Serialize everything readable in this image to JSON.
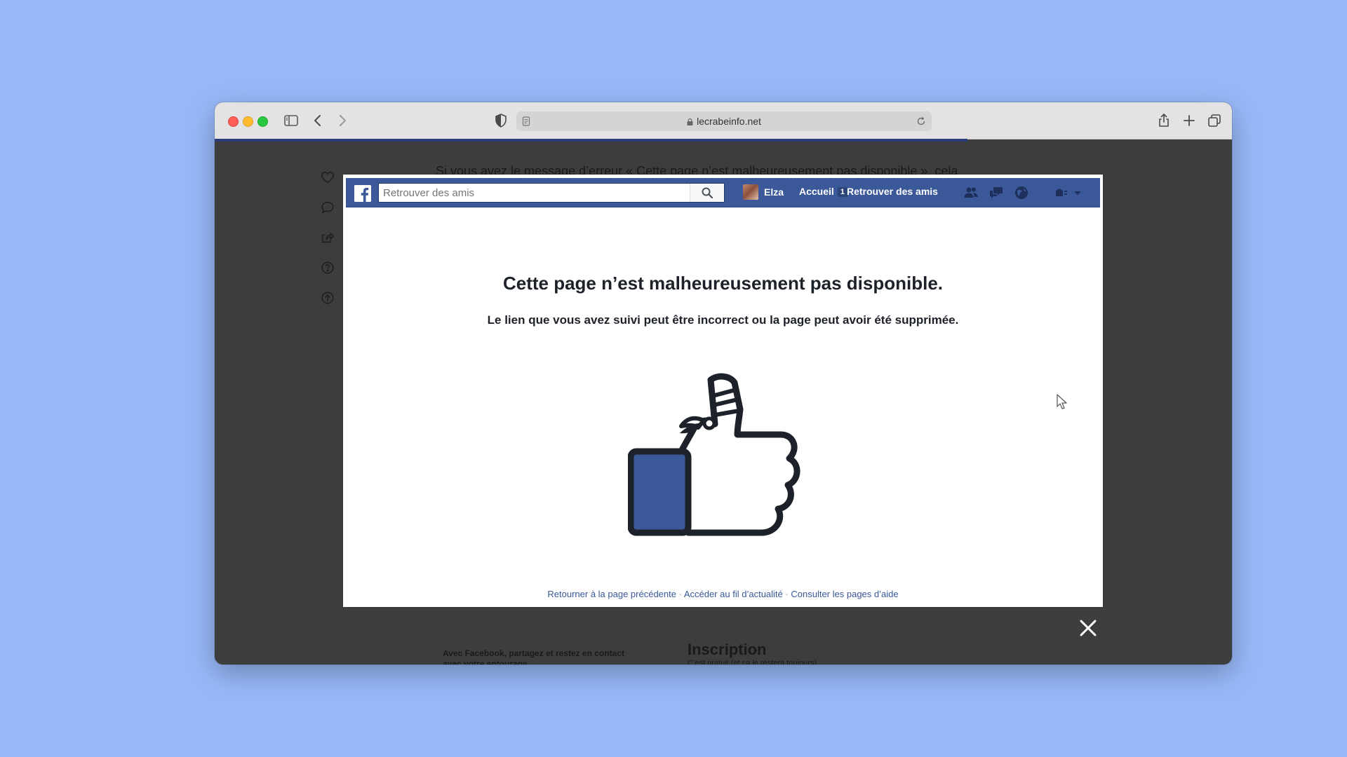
{
  "browser": {
    "url": "lecrabeinfo.net"
  },
  "background_page": {
    "top_text": "Si vous avez le message d’erreur « Cette page n’est malheureusement pas disponible », cela",
    "bottom_text": "Avec Facebook, partagez et restez en contact",
    "bottom_text_line2": "avec votre entourage.",
    "heading": "Inscription",
    "heading_sub": "C’est gratuit (et ça le restera toujours)"
  },
  "facebook": {
    "search_placeholder": "Retrouver des amis",
    "profile_name": "Elza",
    "nav_home": "Accueil",
    "nav_home_badge": "1",
    "nav_find_friends": "Retrouver des amis",
    "brand_color": "#3b5998"
  },
  "error": {
    "title": "Cette page n’est malheureusement pas disponible.",
    "subtitle": "Le lien que vous avez suivi peut être incorrect ou la page peut avoir été supprimée."
  },
  "footer": {
    "link_back": "Retourner à la page précédente",
    "link_feed": "Accéder au fil d’actualité",
    "link_help": "Consulter les pages d’aide",
    "separator": "·"
  }
}
